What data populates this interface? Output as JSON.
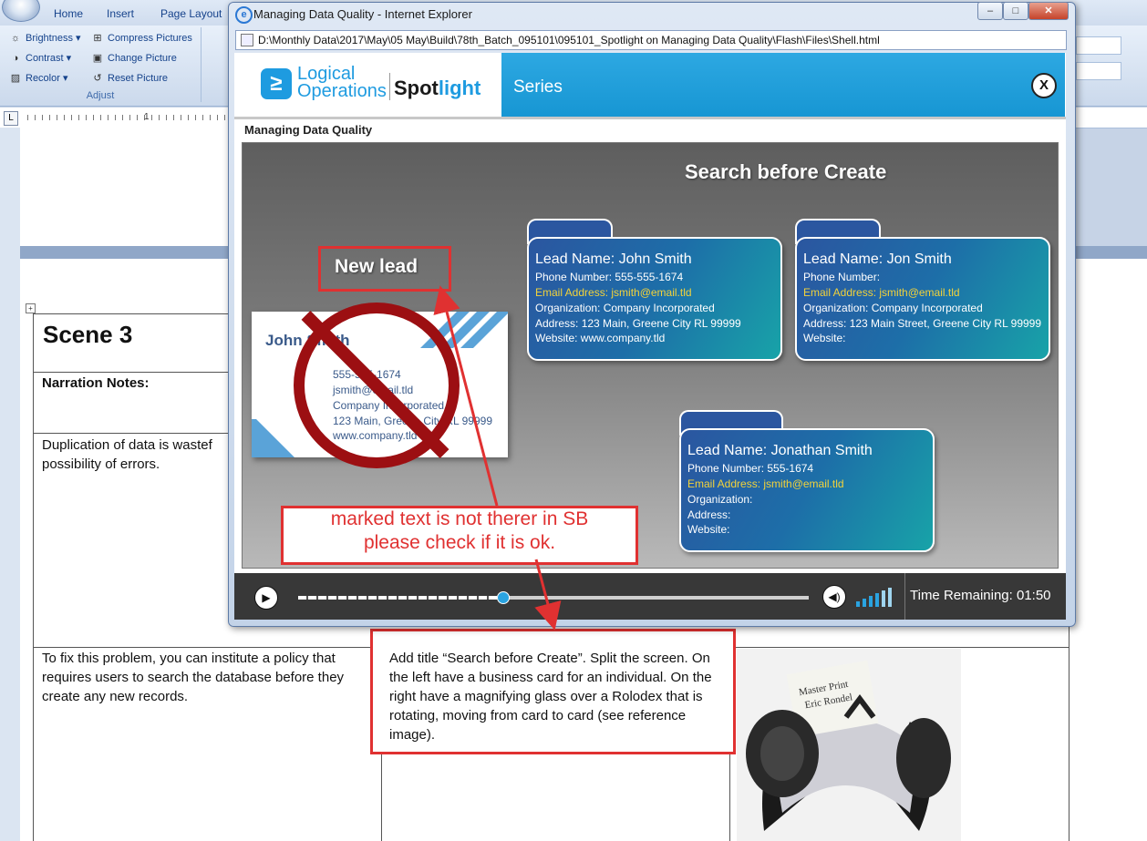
{
  "word": {
    "tabs": [
      "Home",
      "Insert",
      "Page Layout"
    ],
    "adjust": {
      "brightness": "Brightness",
      "contrast": "Contrast",
      "recolor": "Recolor",
      "compress": "Compress Pictures",
      "change": "Change Picture",
      "reset": "Reset Picture",
      "group_label": "Adjust"
    },
    "ruler_num": "1",
    "table": {
      "scene_title": "Scene 3",
      "narration_label": "Narration Notes:",
      "row1_text": "Duplication of data is wastef possibility of errors.",
      "row2_col1": "To fix this problem, you can institute a policy that requires users to search the database before they create any new records.",
      "row2_col2": "Add title “Search before Create”. Split the screen. On the left have a business card for an individual. On the right have a magnifying glass over a Rolodex that is rotating, moving from card to card (see reference image)."
    }
  },
  "ie": {
    "title": "Managing Data Quality - Internet Explorer",
    "address": "D:\\Monthly Data\\2017\\May\\05 May\\Build\\78th_Batch_095101\\095101_Spotlight on Managing Data Quality\\Flash\\Files\\Shell.html",
    "header": {
      "logo_line1": "Logical",
      "logo_line2": "Operations",
      "spot_a": "Spot",
      "spot_b": "light",
      "series": "Series",
      "close": "X"
    },
    "course_title": "Managing Data Quality",
    "slide": {
      "title": "Search before Create",
      "new_lead": "New lead",
      "business_card": {
        "name": "John Smith",
        "phone": "555-555-1674",
        "email": "jsmith@email.tld",
        "org": "Company Incorporated",
        "address": "123 Main, Greene City RL 99999",
        "website": "www.company.tld"
      },
      "records": [
        {
          "lead": "Lead Name:  John Smith",
          "phone": "Phone Number:  555-555-1674",
          "email": "Email Address:  jsmith@email.tld",
          "org": "Organization:  Company Incorporated",
          "address": "Address: 123 Main, Greene City RL 99999",
          "website": "Website:  www.company.tld"
        },
        {
          "lead": "Lead Name:  Jon Smith",
          "phone": "Phone Number:",
          "email": "Email Address:  jsmith@email.tld",
          "org": "Organization:  Company Incorporated",
          "address": "Address: 123 Main Street, Greene City RL 99999",
          "website": "Website:"
        },
        {
          "lead": "Lead Name:  Jonathan Smith",
          "phone": "Phone Number:  555-1674",
          "email": "Email Address:  jsmith@email.tld",
          "org": "Organization:",
          "address": "Address:",
          "website": "Website:"
        }
      ]
    },
    "player": {
      "time_remaining": "Time Remaining: 01:50",
      "progress": 0.4
    }
  },
  "annotation": {
    "line1": "marked text is not therer in SB",
    "line2": "please check if it is ok."
  },
  "colors": {
    "accent_blue": "#1e9be0",
    "annotation_red": "#e03131",
    "email_yellow": "#f2d23a",
    "prohibit_red": "#9c0f12"
  }
}
